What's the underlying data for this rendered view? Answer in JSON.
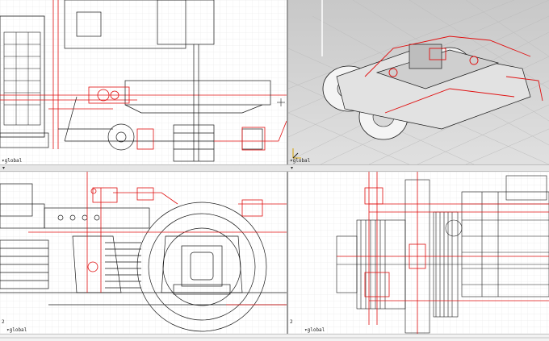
{
  "viewports": {
    "top_left": {
      "label": "global"
    },
    "top_right": {
      "label": "global"
    },
    "bottom_left": {
      "label": "global",
      "axis": "2"
    },
    "bottom_right": {
      "label": "global",
      "axis": "2"
    }
  },
  "colors": {
    "line": "#1a1a1a",
    "accent": "#e01010",
    "grid": "#e4e4e4",
    "grid_major": "#cfcfcf",
    "shaded_bg": "#d2d2d2"
  },
  "icons": [
    "axis-gizmo-icon",
    "viewport-arrow-icon"
  ]
}
